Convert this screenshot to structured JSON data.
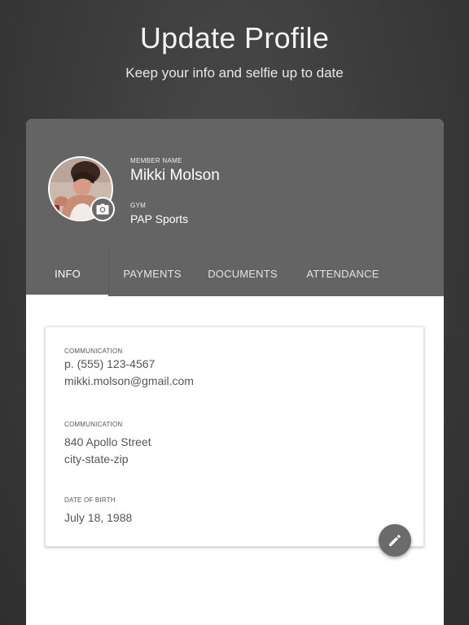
{
  "header": {
    "title": "Update Profile",
    "subtitle": "Keep your info and selfie up to date"
  },
  "profile": {
    "member_name_label": "MEMBER NAME",
    "member_name": "Mikki Molson",
    "gym_label": "GYM",
    "gym_name": "PAP Sports",
    "camera_icon": "camera-icon"
  },
  "tabs": [
    {
      "label": "INFO",
      "active": true
    },
    {
      "label": "PAYMENTS",
      "active": false
    },
    {
      "label": "DOCUMENTS",
      "active": false
    },
    {
      "label": "ATTENDANCE",
      "active": false
    }
  ],
  "info": {
    "phone_label": "COMMUNICATION",
    "phone": "p. (555) 123-4567",
    "email": "mikki.molson@gmail.com",
    "address_label": "COMMUNICATION",
    "street": "840 Apollo Street",
    "city_state_zip": "city-state-zip",
    "dob_label": "DATE OF BIRTH",
    "dob": "July 18, 1988"
  },
  "actions": {
    "edit_icon": "pencil-icon"
  },
  "colors": {
    "background": "#3a3a3a",
    "header": "#646464",
    "card": "#ffffff",
    "fab": "#6b6b6b"
  }
}
